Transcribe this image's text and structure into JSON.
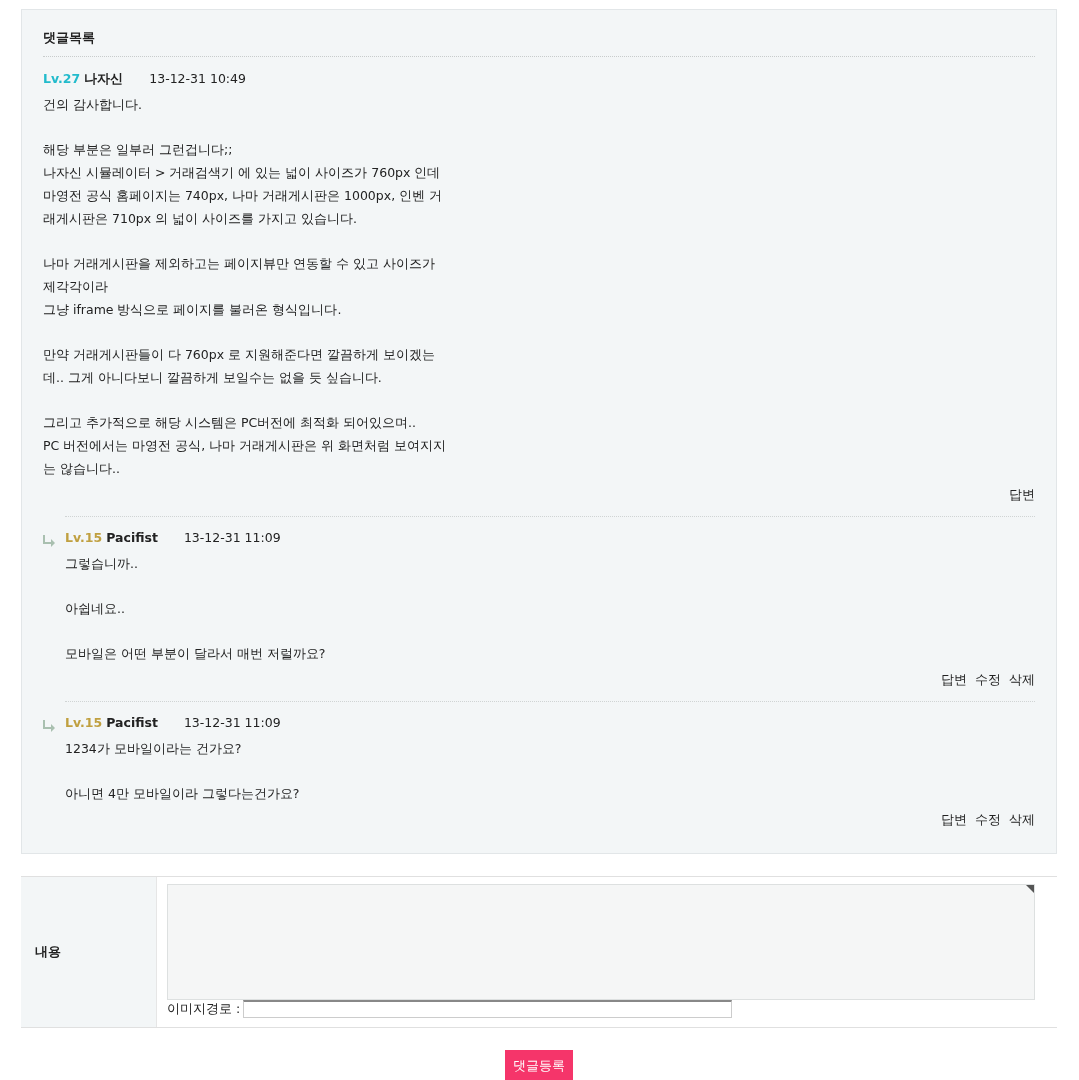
{
  "comments_title": "댓글목록",
  "comments": [
    {
      "kind": "comment",
      "level": "Lv.27",
      "color": "#22bbcc",
      "author": "나자신",
      "date": "13-12-31 10:49",
      "paragraphs": [
        [
          "건의 감사합니다."
        ],
        [
          "해당 부분은 일부러 그런겁니다;;",
          "나자신 시뮬레이터 > 거래검색기 에 있는 넓이 사이즈가 760px 인데",
          "마영전 공식 홈페이지는 740px, 나마 거래게시판은 1000px, 인벤 거",
          "래게시판은 710px 의 넓이 사이즈를 가지고 있습니다."
        ],
        [
          "나마 거래게시판을 제외하고는 페이지뷰만 연동할 수 있고 사이즈가",
          "제각각이라",
          "그냥 iframe 방식으로 페이지를 불러온 형식입니다."
        ],
        [
          "만약 거래게시판들이 다 760px 로 지원해준다면 깔끔하게 보이겠는",
          "데.. 그게 아니다보니 깔끔하게 보일수는 없을 듯 싶습니다."
        ],
        [
          "그리고 추가적으로 해당 시스템은 PC버전에 최적화 되어있으며..",
          "PC 버전에서는 마영전 공식, 나마 거래게시판은 위 화면처럼 보여지지",
          "는 않습니다.."
        ]
      ],
      "actions": [
        "답변"
      ]
    },
    {
      "kind": "reply",
      "level": "Lv.15",
      "color": "#c0a040",
      "author": "Pacifist",
      "date": "13-12-31 11:09",
      "paragraphs": [
        [
          "그렇습니까.."
        ],
        [
          "아쉽네요.."
        ],
        [
          "모바일은 어떤 부분이 달라서 매번 저럴까요?"
        ]
      ],
      "actions": [
        "답변",
        "수정",
        "삭제"
      ]
    },
    {
      "kind": "reply",
      "level": "Lv.15",
      "color": "#c0a040",
      "author": "Pacifist",
      "date": "13-12-31 11:09",
      "paragraphs": [
        [
          "1234가 모바일이라는 건가요?"
        ],
        [
          "아니면 4만 모바일이라 그렇다는건가요?"
        ]
      ],
      "actions": [
        "답변",
        "수정",
        "삭제"
      ]
    }
  ],
  "form": {
    "content_label": "내용",
    "image_path_label": "이미지경로 :",
    "submit": "댓글등록"
  }
}
